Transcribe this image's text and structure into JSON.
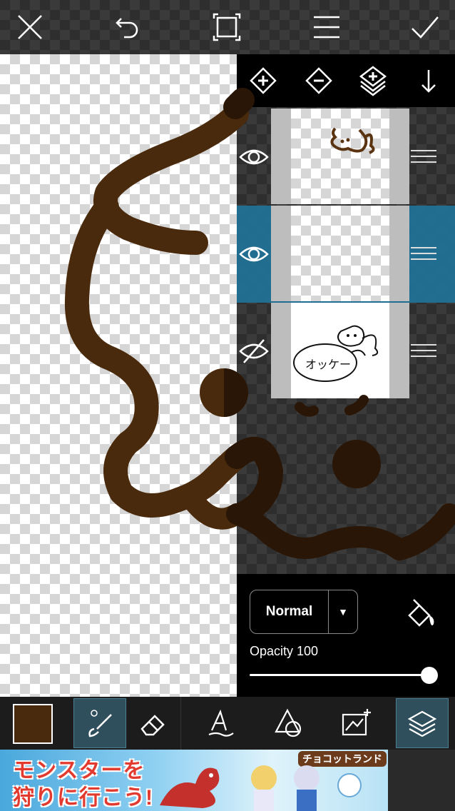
{
  "top_toolbar": {
    "close": "close-icon",
    "undo": "undo-icon",
    "fit": "fit-screen-icon",
    "menu": "menu-icon",
    "confirm": "checkmark-icon"
  },
  "layers_toolbar": {
    "add": "add-layer-icon",
    "remove": "remove-layer-icon",
    "duplicate": "duplicate-layer-icon",
    "merge_down": "merge-down-icon"
  },
  "layers": [
    {
      "visible": true,
      "selected": false
    },
    {
      "visible": true,
      "selected": true
    },
    {
      "visible": false,
      "selected": false
    }
  ],
  "thumbnail_text": "オッケー",
  "layer_properties": {
    "blend_mode": "Normal",
    "dropdown_arrow": "▼",
    "opacity_label": "Opacity 100",
    "opacity_value": 100
  },
  "bottom_toolbar": {
    "color": "#4a2a0c",
    "tools": [
      "brush",
      "eraser",
      "text",
      "shape",
      "image",
      "layers"
    ],
    "active_tools": [
      "brush",
      "layers"
    ]
  },
  "ad": {
    "line1": "モンスターを",
    "line2": "狩りに行こう!",
    "brand": "チョコットランド"
  },
  "colors": {
    "stroke": "#4a2a0c",
    "selected_layer": "#1e78a0"
  }
}
